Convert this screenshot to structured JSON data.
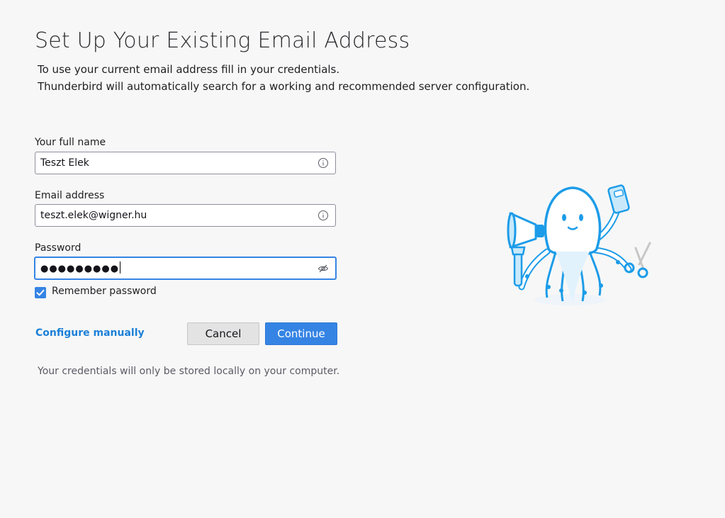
{
  "header": {
    "title": "Set Up Your Existing Email Address",
    "line1": "To use your current email address fill in your credentials.",
    "line2": "Thunderbird will automatically search for a working and recommended server configuration."
  },
  "form": {
    "fullname": {
      "label": "Your full name",
      "value": "Teszt Elek",
      "icon": "info-icon"
    },
    "email": {
      "label": "Email address",
      "value": "teszt.elek@wigner.hu",
      "icon": "info-icon"
    },
    "password": {
      "label": "Password",
      "masked_value": "●●●●●●●●●",
      "icon": "eye-slash-icon"
    },
    "remember": {
      "label": "Remember password",
      "checked": true
    }
  },
  "actions": {
    "configure_manually": "Configure manually",
    "cancel": "Cancel",
    "continue": "Continue"
  },
  "footer": {
    "note": "Your credentials will only be stored locally on your computer."
  },
  "colors": {
    "accent": "#3584e4",
    "link": "#1c80d8",
    "background": "#f7f7f7"
  },
  "illustration": {
    "icon": "octopus-mascot-illustration"
  }
}
